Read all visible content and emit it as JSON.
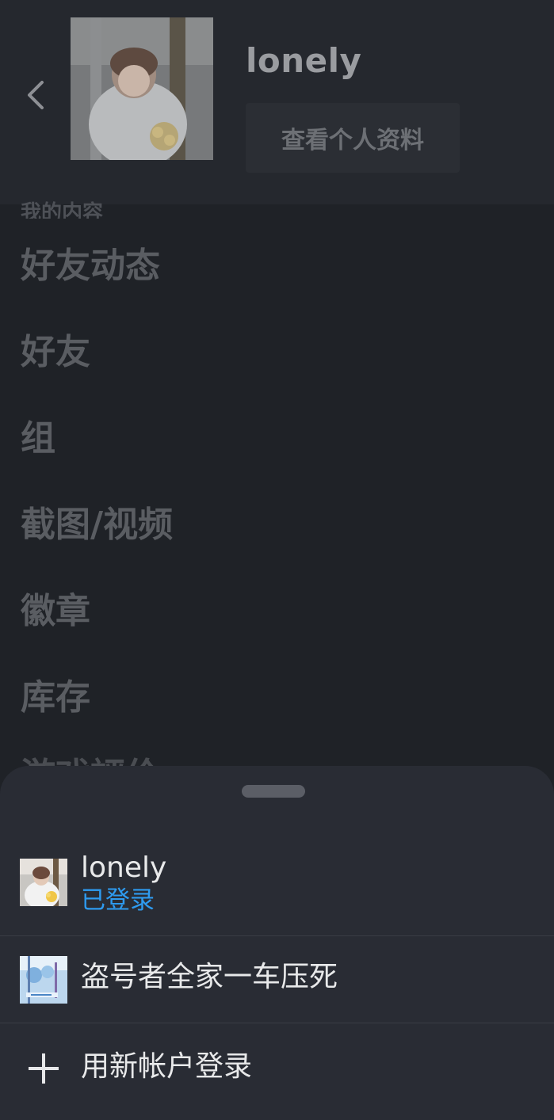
{
  "profile": {
    "name": "lonely",
    "view_profile_label": "查看个人资料"
  },
  "section": {
    "label": "我的内容"
  },
  "menu": {
    "items": [
      {
        "label": "好友动态"
      },
      {
        "label": "好友"
      },
      {
        "label": "组"
      },
      {
        "label": "截图/视频"
      },
      {
        "label": "徽章"
      },
      {
        "label": "库存"
      }
    ],
    "partial_item": "游戏評价"
  },
  "account_sheet": {
    "accounts": [
      {
        "name": "lonely",
        "status": "已登录"
      },
      {
        "name": "盗号者全家一车压死"
      }
    ],
    "add_account_label": "用新帐户登录"
  },
  "colors": {
    "status_blue": "#2e9bf0",
    "sheet_bg": "#292c34",
    "page_bg": "#1f2227"
  },
  "icons": [
    "back-chevron-icon",
    "plus-icon"
  ]
}
